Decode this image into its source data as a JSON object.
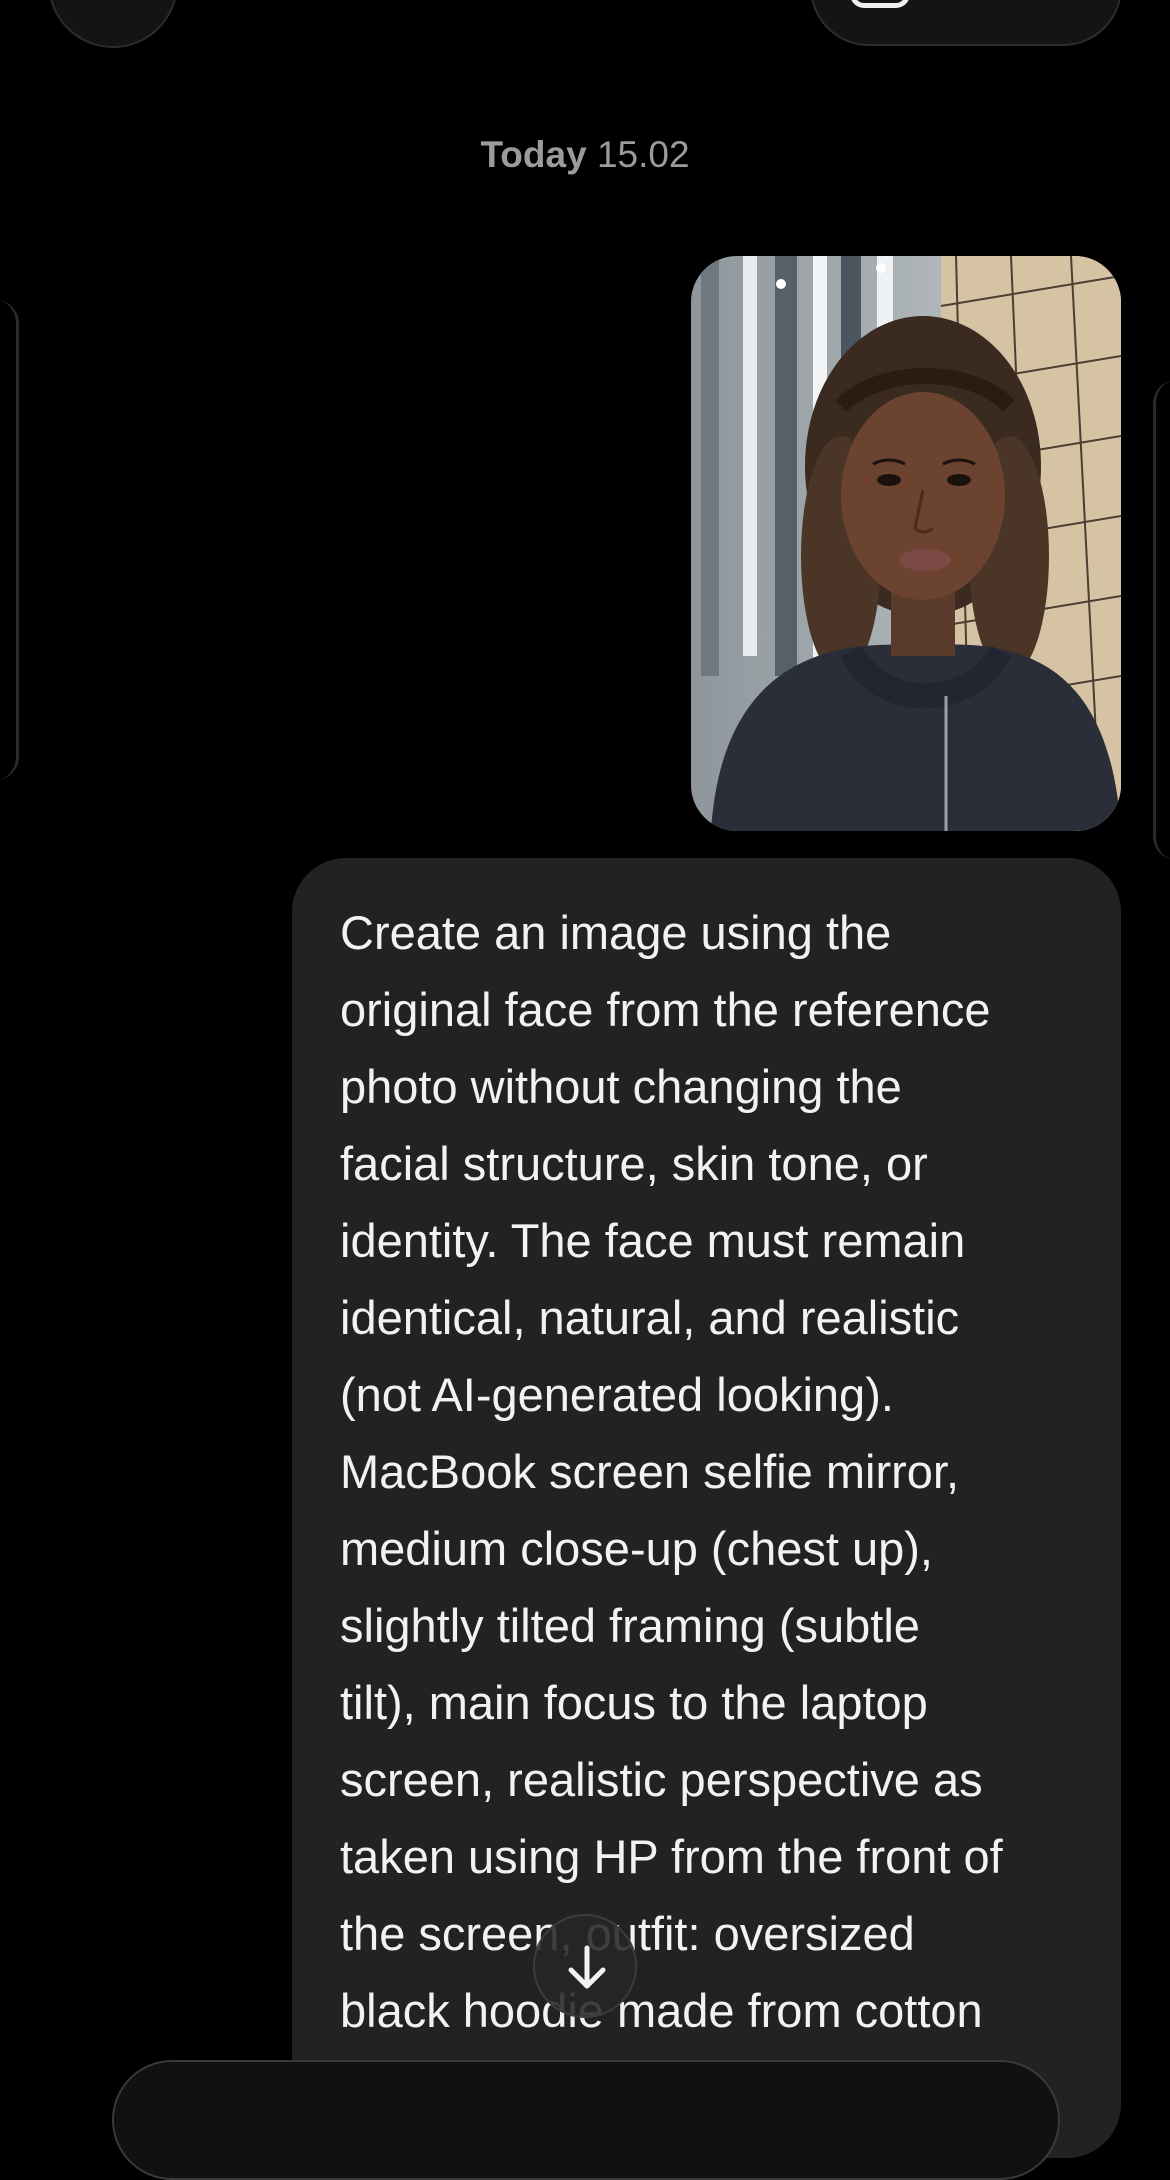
{
  "header": {
    "left_button_icon": "back-circle-icon",
    "right_button_icon": "action-pill-icon"
  },
  "timestamp": {
    "day": "Today",
    "time": "15.02"
  },
  "photo_message": {
    "description_icon": "selfie-photo"
  },
  "text_message": {
    "lines": [
      "Create an image using the",
      "original face from the reference",
      "photo without changing the",
      "facial structure, skin tone, or",
      "identity. The face must remain",
      "identical, natural, and realistic",
      "(not AI-generated looking).",
      "MacBook screen selfie mirror,",
      "medium close-up (chest up),",
      "slightly tilted framing (subtle",
      "tilt), main focus to the laptop",
      "screen, realistic perspective as",
      "taken using HP from the front of",
      "the screen, outfit: oversized",
      "black hoodie made from cotton"
    ]
  },
  "scroll_button": {
    "icon": "arrow-down-icon"
  },
  "colors": {
    "background": "#000000",
    "bubble": "#222222",
    "timestamp": "#9b9b9b"
  }
}
